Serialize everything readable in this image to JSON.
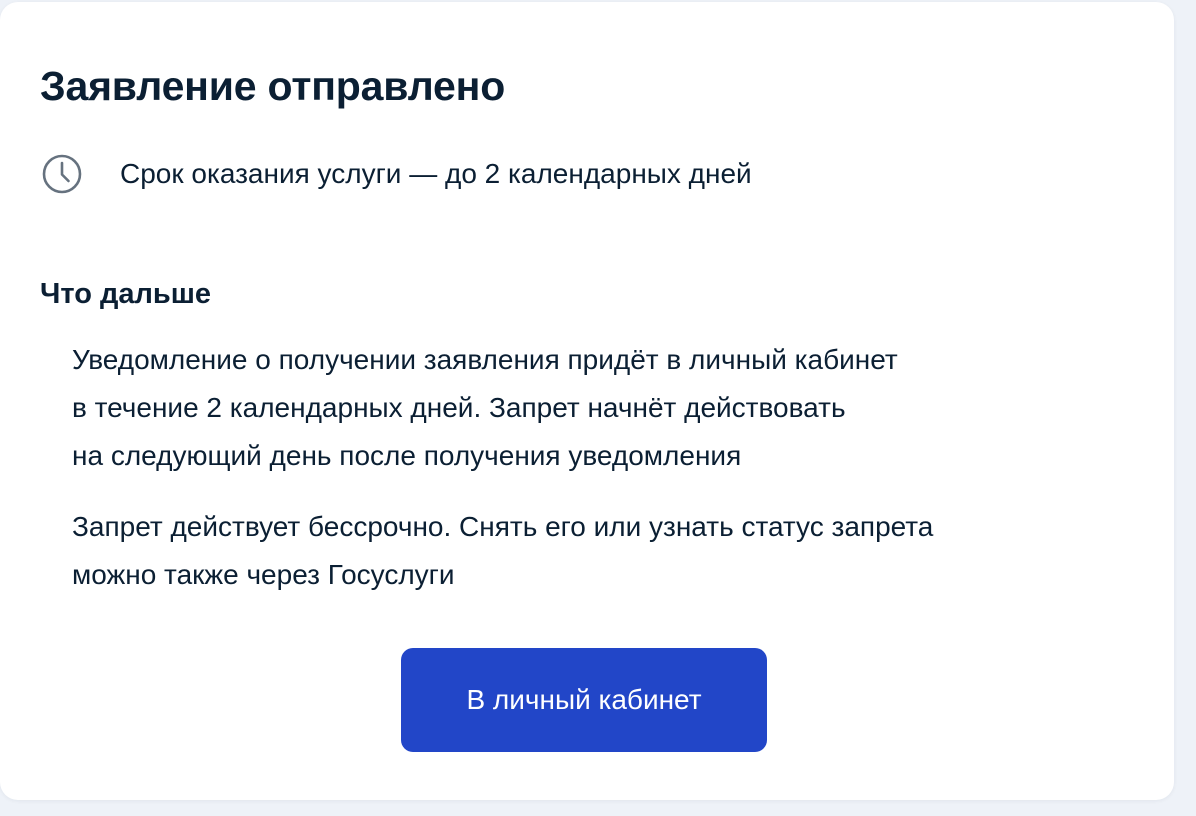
{
  "header": {
    "title": "Заявление отправлено"
  },
  "service_term": {
    "icon": "clock-icon",
    "text": "Срок оказания услуги — до 2 календарных дней"
  },
  "next_steps": {
    "title": "Что дальше",
    "paragraph_1": {
      "lines": [
        "Уведомление о получении заявления придёт в личный кабинет",
        "в течение 2 календарных дней. Запрет начнёт действовать",
        "на следующий день после получения уведомления"
      ]
    },
    "paragraph_2": {
      "lines": [
        "Запрет действует бессрочно. Снять его или узнать статус запрета",
        "можно также через Госуслуги"
      ]
    }
  },
  "actions": {
    "cabinet_button_label": "В личный кабинет"
  },
  "colors": {
    "primary_button": "#2246c8",
    "text": "#0b1f33",
    "icon": "#66727f",
    "background": "#eef2f8"
  }
}
